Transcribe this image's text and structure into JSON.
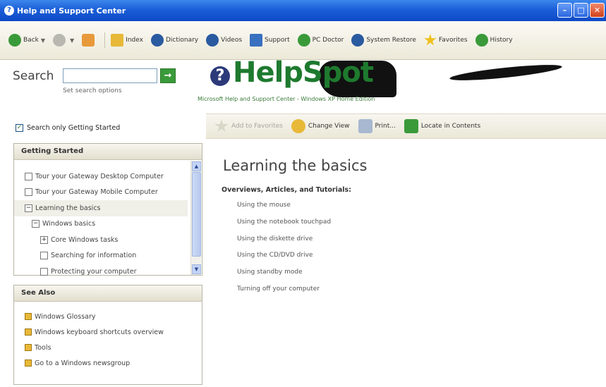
{
  "window": {
    "title": "Help and Support Center",
    "controls": {
      "minimize": "–",
      "maximize": "□",
      "close": "✕"
    }
  },
  "toolbar": {
    "items": [
      {
        "label": "Back",
        "icon": "back-arrow-icon",
        "color": "#3a9a3a",
        "dropdown": true
      },
      {
        "label": "",
        "icon": "forward-arrow-icon",
        "color": "#b8b8b0",
        "dropdown": true
      },
      {
        "label": "",
        "icon": "home-icon",
        "color": "#e89a3a"
      },
      {
        "label": "Index",
        "icon": "index-book-icon",
        "color": "#e8b938"
      },
      {
        "label": "Dictionary",
        "icon": "dictionary-icon",
        "color": "#2a5aa0"
      },
      {
        "label": "Videos",
        "icon": "videos-icon",
        "color": "#2a5aa0"
      },
      {
        "label": "Support",
        "icon": "support-icon",
        "color": "#3a70c0"
      },
      {
        "label": "PC Doctor",
        "icon": "pc-doctor-icon",
        "color": "#3a9a3a"
      },
      {
        "label": "System Restore",
        "icon": "system-restore-icon",
        "color": "#2a5aa0"
      },
      {
        "label": "Favorites",
        "icon": "favorites-star-icon",
        "color": "#f0c020"
      },
      {
        "label": "History",
        "icon": "history-icon",
        "color": "#3a9a3a"
      }
    ]
  },
  "search": {
    "label": "Search",
    "value": "",
    "go": "→",
    "options_link": "Set search options",
    "only_checkbox": {
      "label": "Search only Getting Started",
      "checked": true
    }
  },
  "getting_started": {
    "header": "Getting Started",
    "items": [
      {
        "label": "Tour your Gateway Desktop Computer",
        "state": ""
      },
      {
        "label": "Tour your Gateway Mobile Computer",
        "state": ""
      },
      {
        "label": "Learning the basics",
        "state": "−"
      },
      {
        "label": "Windows basics",
        "state": "−"
      },
      {
        "label": "Core Windows tasks",
        "state": "+"
      },
      {
        "label": "Searching for information",
        "state": ""
      },
      {
        "label": "Protecting your computer",
        "state": ""
      }
    ]
  },
  "see_also": {
    "header": "See Also",
    "items": [
      "Windows Glossary",
      "Windows keyboard shortcuts overview",
      "Tools",
      "Go to a Windows newsgroup"
    ]
  },
  "brand": {
    "name": "HelpSpot",
    "subtitle": "Microsoft Help and Support Center - Windows XP Home Edition",
    "color": "#1e7a2e"
  },
  "actions": {
    "add_favorites": "Add to Favorites",
    "change_view": "Change View",
    "print": "Print...",
    "locate": "Locate in Contents"
  },
  "content": {
    "title": "Learning the basics",
    "subtitle": "Overviews, Articles, and Tutorials:",
    "links": [
      "Using the mouse",
      "Using the notebook touchpad",
      "Using the diskette drive",
      "Using the CD/DVD drive",
      "Using standby mode",
      "Turning off your computer"
    ]
  }
}
